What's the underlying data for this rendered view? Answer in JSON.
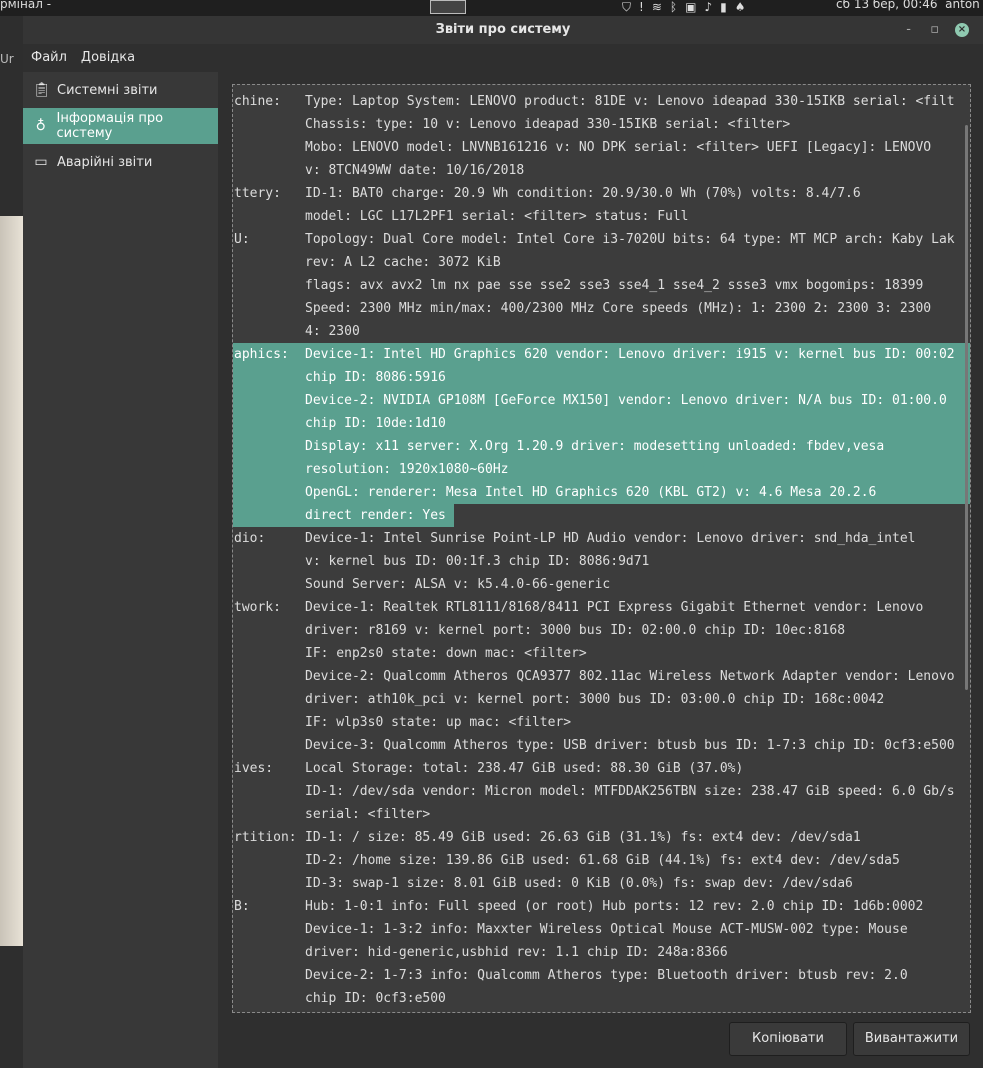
{
  "top_panel": {
    "terminal_title": "рмінал -",
    "clock": "сб 13 бер, 00:46",
    "user": "anton"
  },
  "background": {
    "left_text": "Ur"
  },
  "window": {
    "title": "Звіти про систему",
    "minimize": "-",
    "maximize": "▫",
    "close": "×"
  },
  "menu": [
    "Файл",
    "Довідка"
  ],
  "sidebar": {
    "items": [
      {
        "label": "Системні звіти",
        "icon": "clipboard-icon",
        "selected": false
      },
      {
        "label": "Інформація про систему",
        "icon": "lightbulb-icon",
        "selected": true
      },
      {
        "label": "Аварійні звіти",
        "icon": "monitor-sad-icon",
        "selected": false
      }
    ]
  },
  "report": {
    "rows": [
      {
        "label": "chine:",
        "text": "Type: Laptop System: LENOVO product: 81DE v: Lenovo ideapad 330-15IKB serial: <filt"
      },
      {
        "label": "",
        "text": "Chassis: type: 10 v: Lenovo ideapad 330-15IKB serial: <filter>"
      },
      {
        "label": "",
        "text": "Mobo: LENOVO model: LNVNB161216 v: NO DPK serial: <filter> UEFI [Legacy]: LENOVO"
      },
      {
        "label": "",
        "text": "v: 8TCN49WW date: 10/16/2018"
      },
      {
        "label": "ttery:",
        "text": "ID-1: BAT0 charge: 20.9 Wh condition: 20.9/30.0 Wh (70%) volts: 8.4/7.6"
      },
      {
        "label": "",
        "text": "model: LGC L17L2PF1 serial: <filter> status: Full"
      },
      {
        "label": "U:",
        "text": "Topology: Dual Core model: Intel Core i3-7020U bits: 64 type: MT MCP arch: Kaby Lak"
      },
      {
        "label": "",
        "text": "rev: A L2 cache: 3072 KiB"
      },
      {
        "label": "",
        "text": "flags: avx avx2 lm nx pae sse sse2 sse3 sse4_1 sse4_2 ssse3 vmx bogomips: 18399"
      },
      {
        "label": "",
        "text": "Speed: 2300 MHz min/max: 400/2300 MHz Core speeds (MHz): 1: 2300 2: 2300 3: 2300"
      },
      {
        "label": "",
        "text": "4: 2300"
      },
      {
        "label": "aphics:",
        "text": "Device-1: Intel HD Graphics 620 vendor: Lenovo driver: i915 v: kernel bus ID: 00:02",
        "sel": "label"
      },
      {
        "label": "",
        "text": "chip ID: 8086:5916",
        "sel": "full"
      },
      {
        "label": "",
        "text": "Device-2: NVIDIA GP108M [GeForce MX150] vendor: Lenovo driver: N/A bus ID: 01:00.0",
        "sel": "full"
      },
      {
        "label": "",
        "text": "chip ID: 10de:1d10",
        "sel": "full"
      },
      {
        "label": "",
        "text": "Display: x11 server: X.Org 1.20.9 driver: modesetting unloaded: fbdev,vesa",
        "sel": "full"
      },
      {
        "label": "",
        "text": "resolution: 1920x1080~60Hz",
        "sel": "full"
      },
      {
        "label": "",
        "text": "OpenGL: renderer: Mesa Intel HD Graphics 620 (KBL GT2) v: 4.6 Mesa 20.2.6",
        "sel": "full"
      },
      {
        "label": "",
        "text": "direct render: Yes",
        "sel": "partial"
      },
      {
        "label": "dio:",
        "text": "Device-1: Intel Sunrise Point-LP HD Audio vendor: Lenovo driver: snd_hda_intel"
      },
      {
        "label": "",
        "text": "v: kernel bus ID: 00:1f.3 chip ID: 8086:9d71"
      },
      {
        "label": "",
        "text": "Sound Server: ALSA v: k5.4.0-66-generic"
      },
      {
        "label": "twork:",
        "text": "Device-1: Realtek RTL8111/8168/8411 PCI Express Gigabit Ethernet vendor: Lenovo"
      },
      {
        "label": "",
        "text": "driver: r8169 v: kernel port: 3000 bus ID: 02:00.0 chip ID: 10ec:8168"
      },
      {
        "label": "",
        "text": "IF: enp2s0 state: down mac: <filter>"
      },
      {
        "label": "",
        "text": "Device-2: Qualcomm Atheros QCA9377 802.11ac Wireless Network Adapter vendor: Lenovo"
      },
      {
        "label": "",
        "text": "driver: ath10k_pci v: kernel port: 3000 bus ID: 03:00.0 chip ID: 168c:0042"
      },
      {
        "label": "",
        "text": "IF: wlp3s0 state: up mac: <filter>"
      },
      {
        "label": "",
        "text": "Device-3: Qualcomm Atheros type: USB driver: btusb bus ID: 1-7:3 chip ID: 0cf3:e500"
      },
      {
        "label": "ives:",
        "text": "Local Storage: total: 238.47 GiB used: 88.30 GiB (37.0%)"
      },
      {
        "label": "",
        "text": "ID-1: /dev/sda vendor: Micron model: MTFDDAK256TBN size: 238.47 GiB speed: 6.0 Gb/s"
      },
      {
        "label": "",
        "text": "serial: <filter>"
      },
      {
        "label": "rtition:",
        "text": "ID-1: / size: 85.49 GiB used: 26.63 GiB (31.1%) fs: ext4 dev: /dev/sda1"
      },
      {
        "label": "",
        "text": "ID-2: /home size: 139.86 GiB used: 61.68 GiB (44.1%) fs: ext4 dev: /dev/sda5"
      },
      {
        "label": "",
        "text": "ID-3: swap-1 size: 8.01 GiB used: 0 KiB (0.0%) fs: swap dev: /dev/sda6"
      },
      {
        "label": "B:",
        "text": "Hub: 1-0:1 info: Full speed (or root) Hub ports: 12 rev: 2.0 chip ID: 1d6b:0002"
      },
      {
        "label": "",
        "text": "Device-1: 1-3:2 info: Maxxter Wireless Optical Mouse ACT-MUSW-002 type: Mouse"
      },
      {
        "label": "",
        "text": "driver: hid-generic,usbhid rev: 1.1 chip ID: 248a:8366"
      },
      {
        "label": "",
        "text": "Device-2: 1-7:3 info: Qualcomm Atheros type: Bluetooth driver: btusb rev: 2.0"
      },
      {
        "label": "",
        "text": "chip ID: 0cf3:e500"
      }
    ]
  },
  "buttons": {
    "copy": "Копіювати",
    "upload": "Вивантажити"
  },
  "colors": {
    "accent": "#5aa08f"
  }
}
